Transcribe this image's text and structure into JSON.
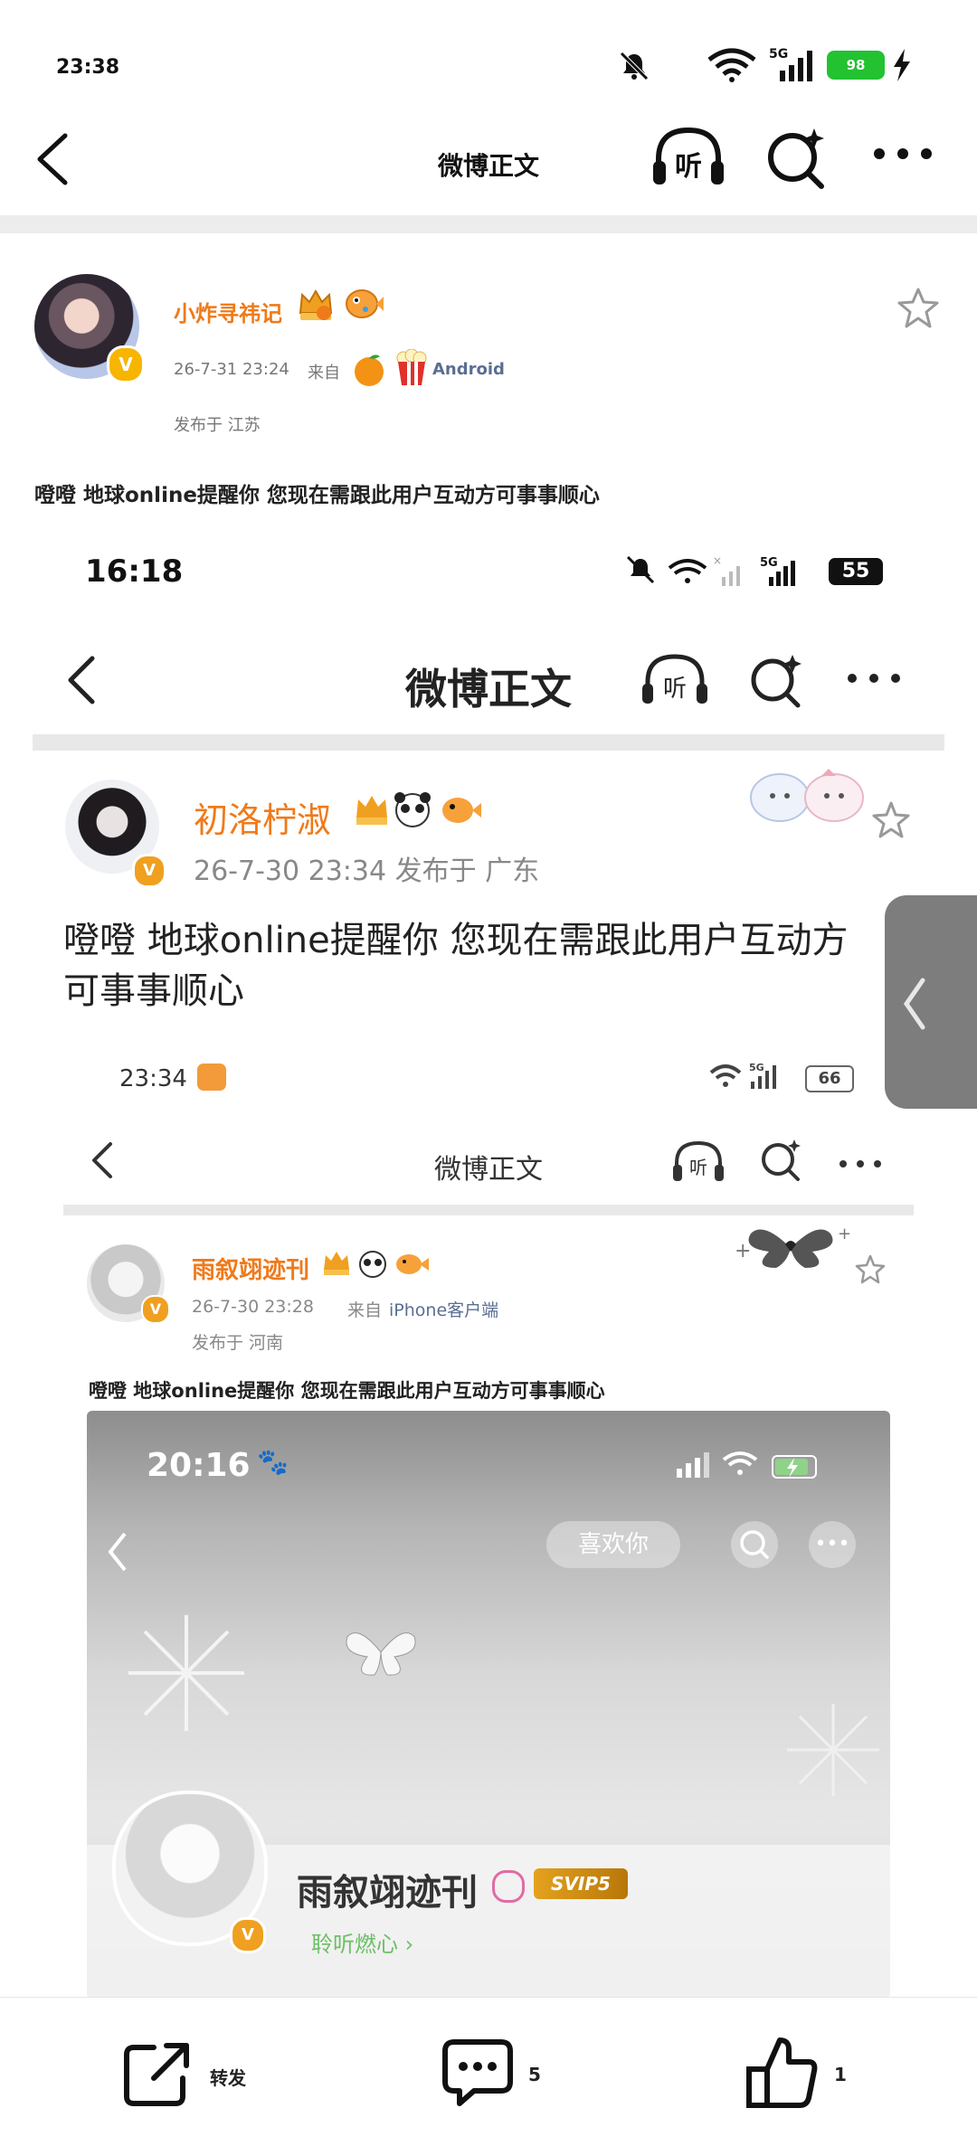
{
  "status_bar": {
    "time": "23:38",
    "battery": "98"
  },
  "header": {
    "title": "微博正文",
    "listen_label": "听"
  },
  "post": {
    "username": "小炸寻祎记",
    "time": "26-7-31 23:24",
    "from_label": "来自",
    "source": "Android",
    "location": "发布于 江苏",
    "text": "噔噔 地球online提醒你 您现在需跟此用户互动方可事事顺心"
  },
  "shot1": {
    "time": "16:18",
    "battery": "55",
    "title": "微博正文",
    "listen_label": "听",
    "username": "初洛柠淑",
    "meta": "26-7-30 23:34  发布于 广东",
    "text": "噔噔 地球online提醒你 您现在需跟此用户互动方可事事顺心"
  },
  "shot2": {
    "time": "23:34",
    "battery": "66",
    "title": "微博正文",
    "listen_label": "听",
    "username": "雨叙翊迹刊",
    "post_time": "26-7-30 23:28",
    "from_label": "来自",
    "source": "iPhone客户端",
    "location": "发布于 河南",
    "text": "噔噔 地球online提醒你 您现在需跟此用户互动方可事事顺心"
  },
  "shot3": {
    "time": "20:16",
    "like_label": "喜欢你",
    "username": "雨叙翊迹刊",
    "vip": "SVIP5",
    "subtitle": "聆听燃心 ›"
  },
  "bottom_bar": {
    "repost_label": "转发",
    "comment_count": "5",
    "like_count": "1"
  },
  "colors": {
    "accent_orange": "#ef7a1a",
    "battery_green": "#22c231",
    "link_blue": "#5a6f91"
  }
}
